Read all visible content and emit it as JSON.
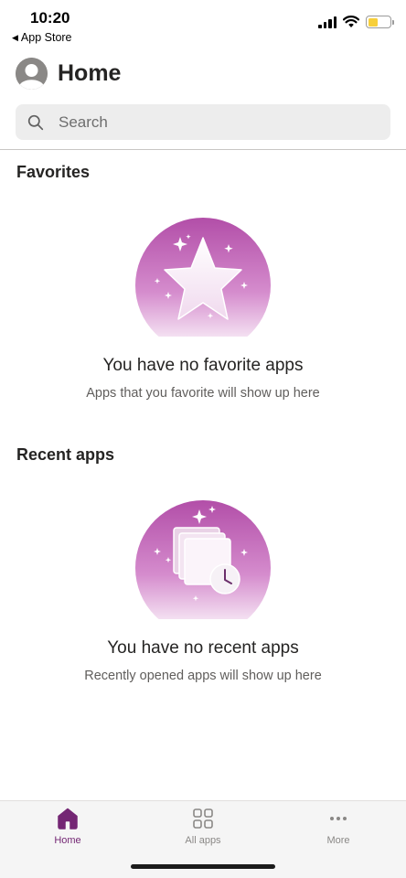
{
  "status_bar": {
    "time": "10:20",
    "back_label": "App Store",
    "battery_level": 0.45
  },
  "header": {
    "title": "Home",
    "avatar_icon": "person-icon"
  },
  "search": {
    "placeholder": "Search",
    "icon": "search-icon"
  },
  "favorites": {
    "title": "Favorites",
    "empty_title": "You have no favorite apps",
    "empty_subtitle": "Apps that you favorite will show up here",
    "illustration": "star-icon"
  },
  "recent": {
    "title": "Recent apps",
    "empty_title": "You have no recent apps",
    "empty_subtitle": "Recently opened apps will show up here",
    "illustration": "recent-documents-clock-icon"
  },
  "tab_bar": {
    "accent_color": "#742774",
    "tabs": [
      {
        "label": "Home",
        "icon": "home-icon",
        "active": true
      },
      {
        "label": "All apps",
        "icon": "grid-icon",
        "active": false
      },
      {
        "label": "More",
        "icon": "more-icon",
        "active": false
      }
    ]
  }
}
